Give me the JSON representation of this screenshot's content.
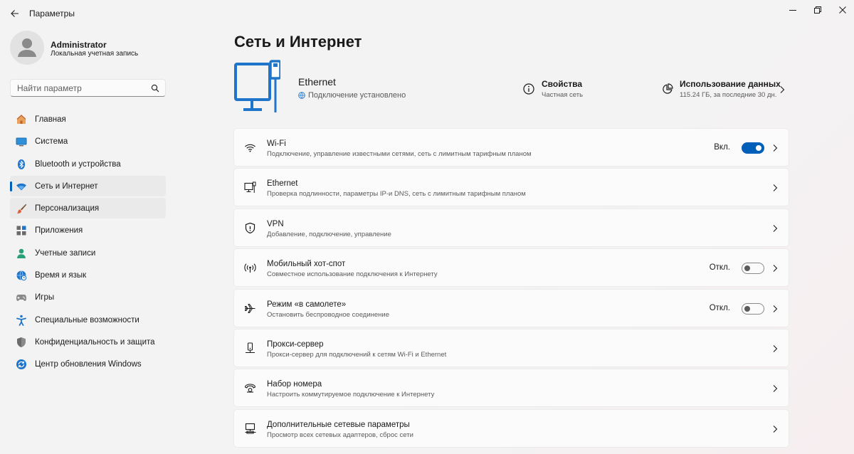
{
  "window": {
    "title": "Параметры"
  },
  "profile": {
    "name": "Administrator",
    "account_type": "Локальная учетная запись"
  },
  "search": {
    "placeholder": "Найти параметр"
  },
  "sidebar": {
    "items": [
      {
        "label": "Главная",
        "icon": "home-icon"
      },
      {
        "label": "Система",
        "icon": "system-icon"
      },
      {
        "label": "Bluetooth и устройства",
        "icon": "bluetooth-icon"
      },
      {
        "label": "Сеть и Интернет",
        "icon": "network-icon",
        "selected": true
      },
      {
        "label": "Персонализация",
        "icon": "brush-icon"
      },
      {
        "label": "Приложения",
        "icon": "apps-icon"
      },
      {
        "label": "Учетные записи",
        "icon": "accounts-icon"
      },
      {
        "label": "Время и язык",
        "icon": "time-language-icon"
      },
      {
        "label": "Игры",
        "icon": "gamepad-icon"
      },
      {
        "label": "Специальные возможности",
        "icon": "accessibility-icon"
      },
      {
        "label": "Конфиденциальность и защита",
        "icon": "shield-icon"
      },
      {
        "label": "Центр обновления Windows",
        "icon": "update-icon"
      }
    ]
  },
  "main": {
    "title": "Сеть и Интернет",
    "hero": {
      "connection_name": "Ethernet",
      "status": "Подключение установлено",
      "properties_title": "Свойства",
      "properties_sub": "Частная сеть",
      "usage_title": "Использование данных",
      "usage_sub": "115.24 ГБ, за последние 30 дн."
    },
    "cards": [
      {
        "title": "Wi-Fi",
        "subtitle": "Подключение, управление известными сетями, сеть с лимитным тарифным планом",
        "icon": "wifi-icon",
        "state": "Вкл.",
        "toggle": "on"
      },
      {
        "title": "Ethernet",
        "subtitle": "Проверка подлинности, параметры IP-и DNS, сеть с лимитным тарифным планом",
        "icon": "ethernet-icon"
      },
      {
        "title": "VPN",
        "subtitle": "Добавление, подключение, управление",
        "icon": "vpn-shield-icon"
      },
      {
        "title": "Мобильный хот-спот",
        "subtitle": "Совместное использование подключения к Интернету",
        "icon": "hotspot-icon",
        "state": "Откл.",
        "toggle": "off"
      },
      {
        "title": "Режим «в самолете»",
        "subtitle": "Остановить беспроводное соединение",
        "icon": "airplane-icon",
        "state": "Откл.",
        "toggle": "off"
      },
      {
        "title": "Прокси-сервер",
        "subtitle": "Прокси-сервер для подключений к сетям Wi-Fi и Ethernet",
        "icon": "proxy-icon"
      },
      {
        "title": "Набор номера",
        "subtitle": "Настроить коммутируемое подключение к Интернету",
        "icon": "dialup-icon"
      },
      {
        "title": "Дополнительные сетевые параметры",
        "subtitle": "Просмотр всех сетевых адаптеров, сброс сети",
        "icon": "network-adapter-icon"
      }
    ]
  },
  "colors": {
    "accent": "#005fb8",
    "hero_icon": "#1f75c9"
  }
}
